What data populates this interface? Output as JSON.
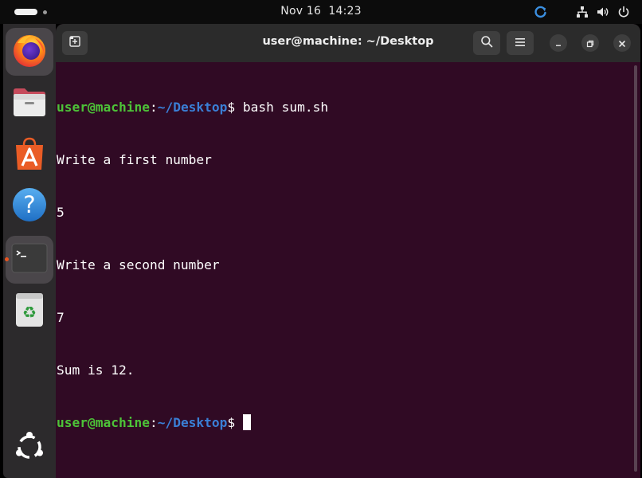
{
  "topbar": {
    "clock_date": "Nov 16",
    "clock_time": "14:23"
  },
  "dock": {
    "apps": [
      {
        "name": "Firefox",
        "icon": "firefox-icon"
      },
      {
        "name": "Files",
        "icon": "files-icon"
      },
      {
        "name": "App Center",
        "icon": "app-center-icon"
      },
      {
        "name": "Help",
        "icon": "help-icon"
      },
      {
        "name": "Terminal",
        "icon": "terminal-icon",
        "running": true
      },
      {
        "name": "Trash",
        "icon": "trash-icon"
      }
    ],
    "show_apps_icon": "ubuntu-logo-icon"
  },
  "window": {
    "title": "user@machine: ~/Desktop"
  },
  "terminal": {
    "prompt_user": "user@machine",
    "prompt_sep": ":",
    "prompt_dir": "~/Desktop",
    "prompt_end": "$ ",
    "command": "bash sum.sh",
    "output": [
      "Write a first number",
      "5",
      "Write a second number",
      "7",
      "Sum is 12."
    ]
  },
  "colors": {
    "terminal_bg": "#300a24",
    "prompt_user": "#4dc338",
    "prompt_dir": "#3a7fd6",
    "accent": "#e95420"
  }
}
